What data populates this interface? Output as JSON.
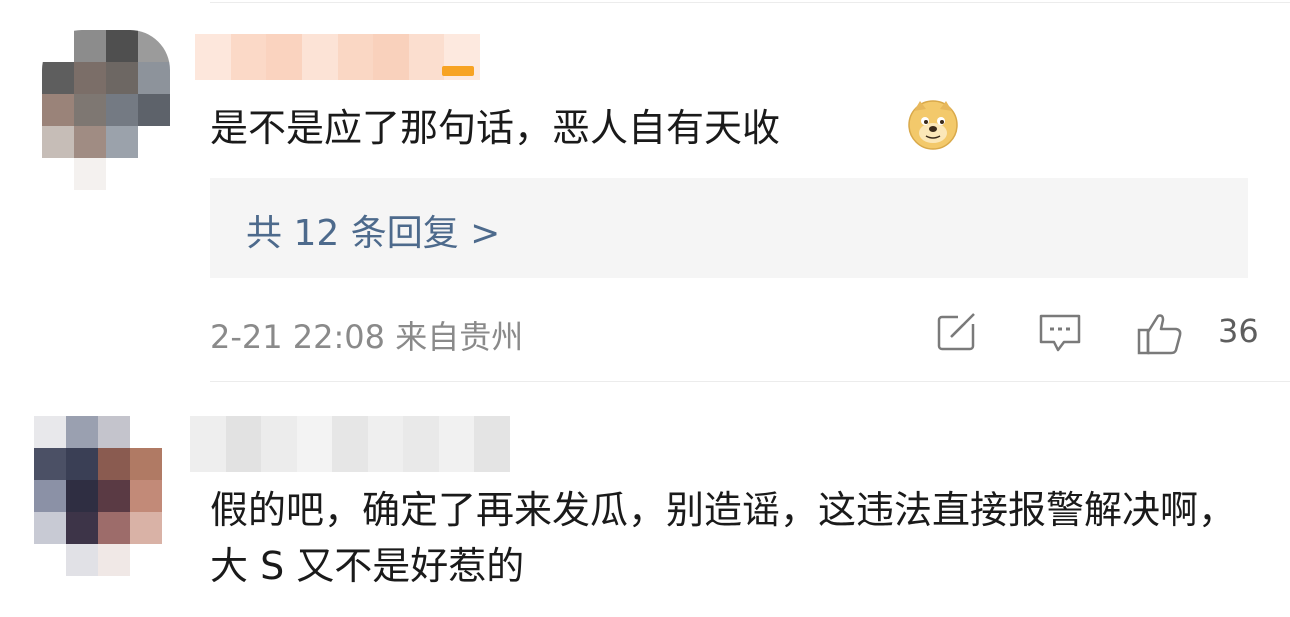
{
  "comments": [
    {
      "text": "是不是应了那句话，恶人自有天收",
      "emoji": "doge-emoji",
      "replies_label": "共 12 条回复 >",
      "timestamp": "2-21 22:08",
      "location": "来自贵州",
      "like_count": "36",
      "icons": [
        "share-icon",
        "comment-icon",
        "like-icon"
      ],
      "avatar_colors": [
        "#ffffff",
        "#8c8c8c",
        "#4f4f4f",
        "#9b9b9b",
        "#5e5e5e",
        "#7b6e68",
        "#6d6763",
        "#8d939b",
        "#9a8379",
        "#7e7772",
        "#747a83",
        "#5d626a",
        "#c6bdb7",
        "#a08c83",
        "#9ba2ab",
        "#ffffff",
        "#ffffff",
        "#f4f1ef",
        "#ffffff",
        "#ffffff"
      ],
      "name_colors": [
        "#fde7dc",
        "#fbd9c7",
        "#fad3bf",
        "#fce3d6",
        "#fad7c4",
        "#f9d1bc",
        "#fbdecf",
        "#fde9df"
      ]
    },
    {
      "text": "假的吧，确定了再来发瓜，别造谣，这违法直接报警解决啊，大 S 又不是好惹的",
      "avatar_colors": [
        "#e8e8eb",
        "#9aa0b0",
        "#c4c4cc",
        "#ffffff",
        "#4b5065",
        "#3a3f55",
        "#8a5b50",
        "#b07a64",
        "#8b91a6",
        "#2f2e42",
        "#5a3a44",
        "#c28a78",
        "#c8cad4",
        "#3d3448",
        "#9d6c6a",
        "#d9b2a6",
        "#ffffff",
        "#e1e1e6",
        "#f0e8e6",
        "#ffffff"
      ],
      "name_colors": [
        "#eeeeee",
        "#e2e2e2",
        "#ececec",
        "#f3f3f3",
        "#e6e6e6",
        "#efefef",
        "#e9e9e9",
        "#f1f1f1",
        "#e4e4e4"
      ]
    }
  ],
  "colors": {
    "link": "#4d6a8c",
    "meta": "#8a8a8a",
    "text": "#1a1a1a",
    "reply_bg": "#f5f5f5"
  }
}
